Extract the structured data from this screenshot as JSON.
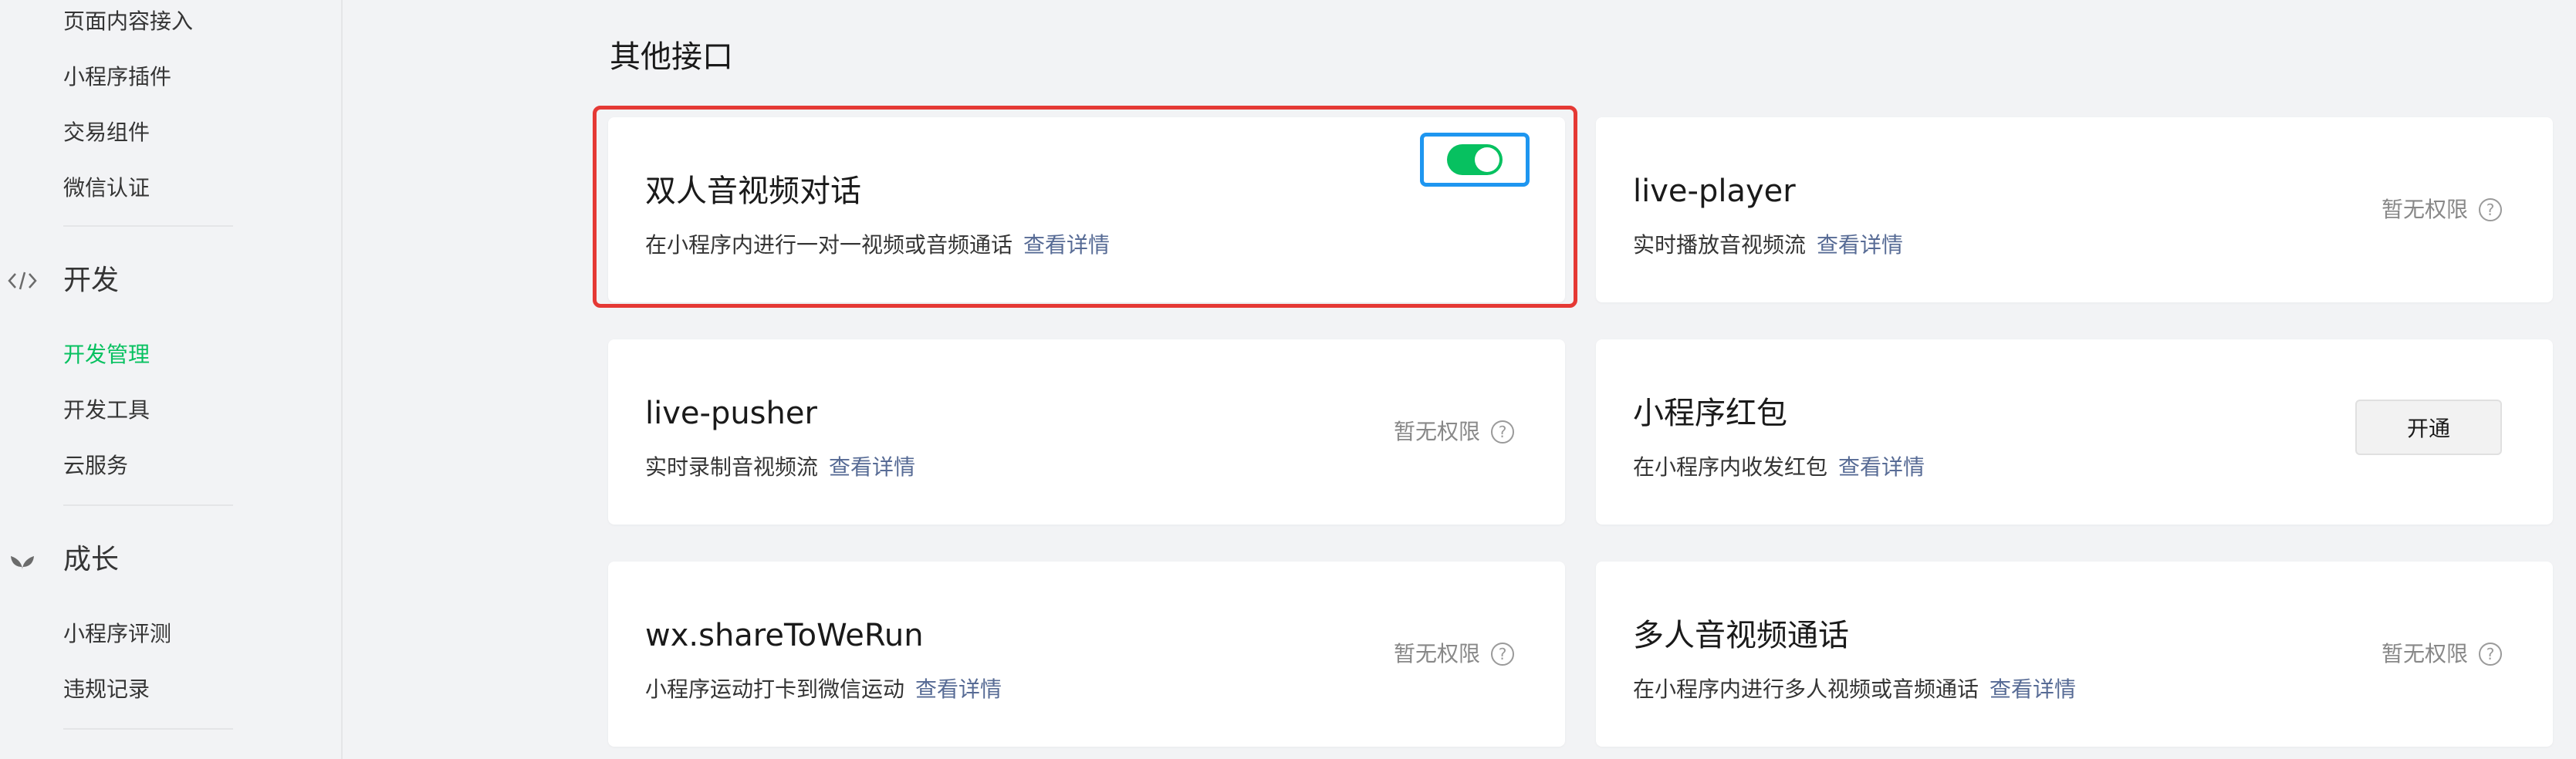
{
  "sidebar": {
    "top_items": [
      {
        "label": "页面内容接入"
      },
      {
        "label": "小程序插件"
      },
      {
        "label": "交易组件"
      },
      {
        "label": "微信认证"
      }
    ],
    "dev_section": {
      "title": "开发",
      "icon": "code-icon",
      "items": [
        {
          "label": "开发管理",
          "active": true
        },
        {
          "label": "开发工具"
        },
        {
          "label": "云服务"
        }
      ]
    },
    "growth_section": {
      "title": "成长",
      "icon": "leaf-icon",
      "items": [
        {
          "label": "小程序评测"
        },
        {
          "label": "违规记录"
        }
      ]
    }
  },
  "main": {
    "title": "其他接口",
    "link_text": "查看详情",
    "no_permission_text": "暂无权限",
    "cards": [
      {
        "title": "双人音视频对话",
        "desc": "在小程序内进行一对一视频或音频通话",
        "control": "switch",
        "switch_on": true
      },
      {
        "title": "live-player",
        "desc": "实时播放音视频流",
        "control": "no-permission"
      },
      {
        "title": "live-pusher",
        "desc": "实时录制音视频流",
        "control": "no-permission"
      },
      {
        "title": "小程序红包",
        "desc": "在小程序内收发红包",
        "control": "button",
        "button_label": "开通"
      },
      {
        "title": "wx.shareToWeRun",
        "desc": "小程序运动打卡到微信运动",
        "control": "no-permission"
      },
      {
        "title": "多人音视频通话",
        "desc": "在小程序内进行多人视频或音频通话",
        "control": "no-permission"
      }
    ]
  },
  "colors": {
    "accent_green": "#07c160",
    "link_blue": "#576b95",
    "highlight_red": "#e53935",
    "highlight_blue": "#1e96f0"
  }
}
